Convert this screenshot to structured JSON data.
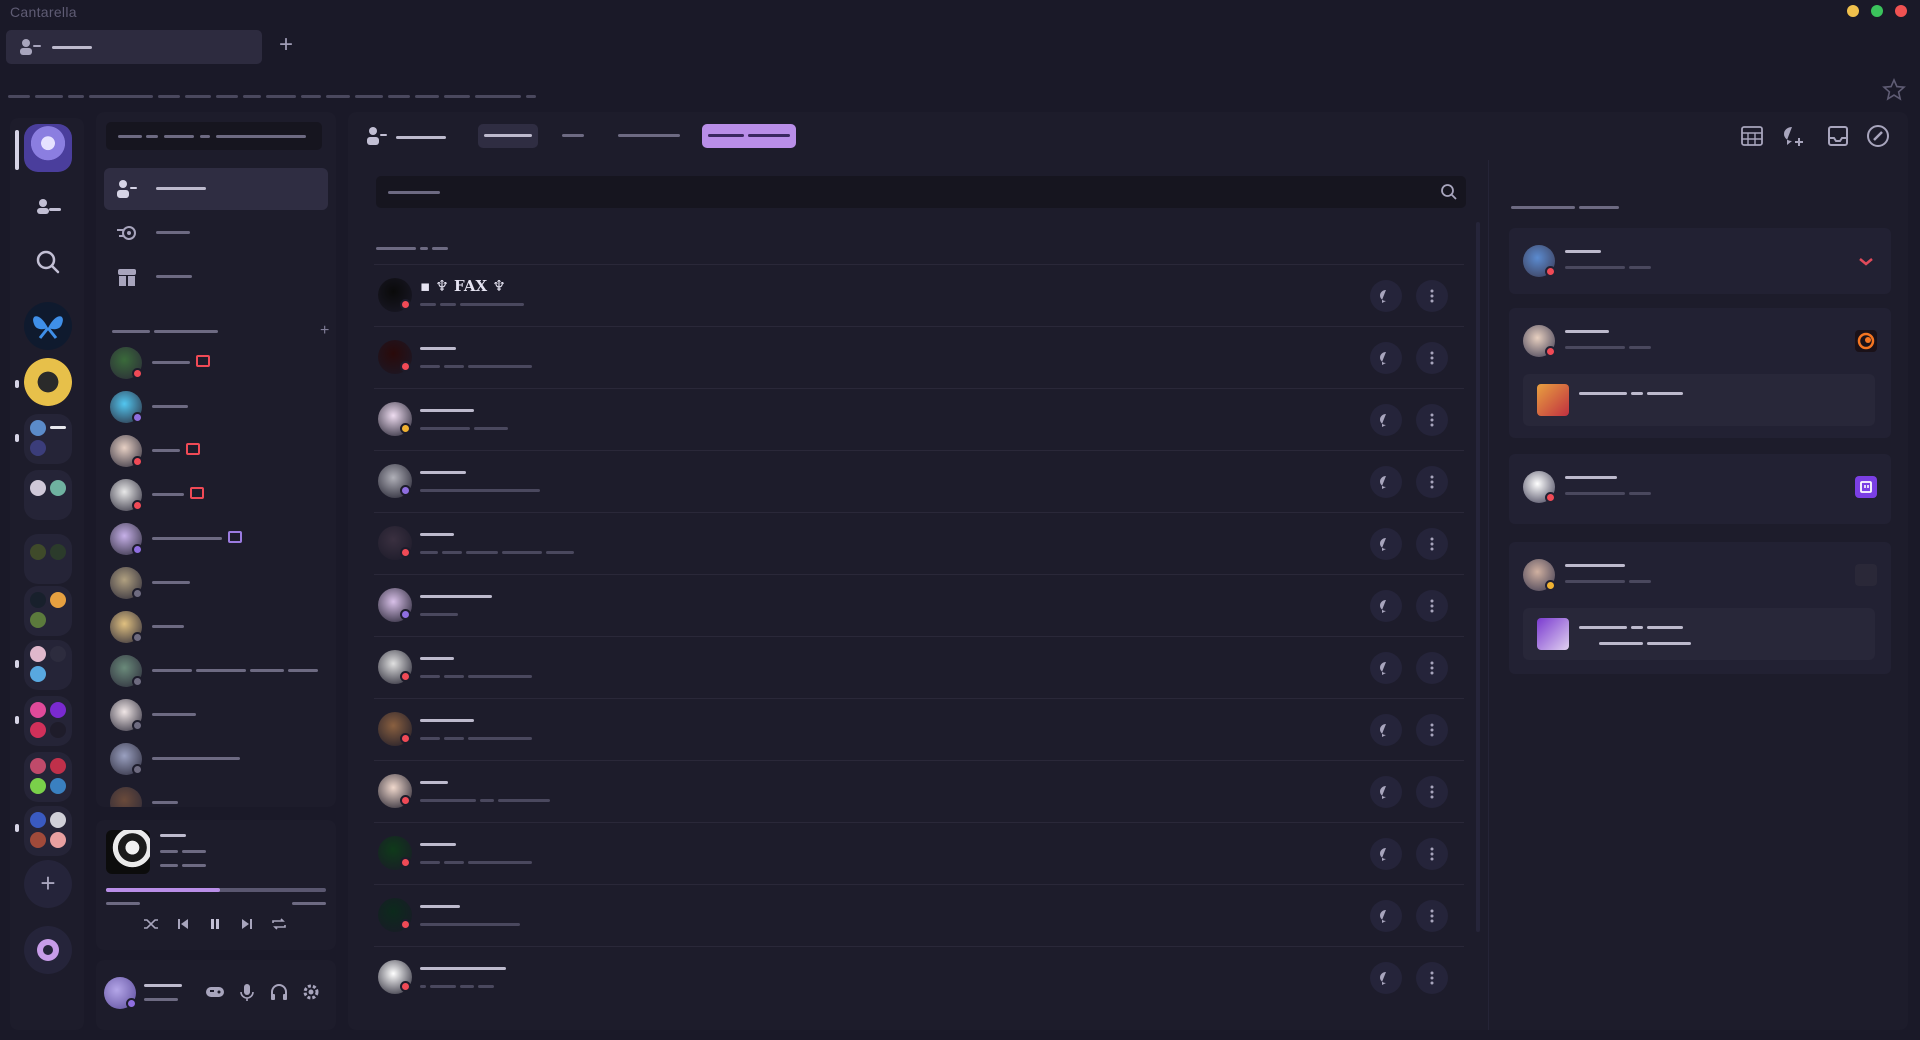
{
  "window": {
    "app_title": "Cantarella",
    "control_colors": [
      "#f0c04c",
      "#3bc35c",
      "#f05252"
    ],
    "new_tab_glyph": "+"
  },
  "tabs": [
    {
      "icon": "friends-icon"
    }
  ],
  "colors": {
    "accent": "#b98ee8",
    "online": "#8f6ee0",
    "dnd": "#f04a56",
    "idle": "#f0b232",
    "offline": "#6e6b80",
    "mobile": "#f04a56"
  },
  "rail": {
    "items": [
      "home-avatar",
      "friends-icon",
      "search-icon",
      "butterfly-server",
      "server-emblem",
      "folder",
      "folder",
      "folder",
      "folder",
      "folder",
      "folder",
      "folder",
      "add-server",
      "discover"
    ],
    "add_glyph": "+"
  },
  "sidebar": {
    "nav": [
      {
        "icon": "friends-icon",
        "active": true
      },
      {
        "icon": "nitro-icon",
        "active": false
      },
      {
        "icon": "shop-icon",
        "active": false
      }
    ],
    "dm_add_glyph": "+",
    "dms": [
      {
        "status": "dnd",
        "badge": "screen-share-icon"
      },
      {
        "status": "online",
        "badge": ""
      },
      {
        "status": "mobile",
        "badge": "game-icon"
      },
      {
        "status": "dnd",
        "badge": "screen-share-icon"
      },
      {
        "status": "online",
        "badge": "screen-share-icon"
      },
      {
        "status": "offline",
        "badge": ""
      },
      {
        "status": "offline",
        "badge": ""
      },
      {
        "status": "offline",
        "badge": ""
      },
      {
        "status": "offline",
        "badge": ""
      },
      {
        "status": "offline",
        "badge": ""
      },
      {
        "status": "offline",
        "badge": ""
      }
    ]
  },
  "player": {
    "progress": 0.52,
    "controls": [
      "shuffle-icon",
      "previous-icon",
      "pause-icon",
      "next-icon",
      "repeat-icon"
    ]
  },
  "userbar": {
    "icons": [
      "game-icon",
      "microphone-icon",
      "headphones-icon",
      "settings-icon"
    ]
  },
  "friends": {
    "rows": [
      {
        "name": "▪ ♆ FAX ♆",
        "status": "dnd"
      },
      {
        "name": "",
        "status": "dnd"
      },
      {
        "name": "",
        "status": "idle"
      },
      {
        "name": "",
        "status": "online"
      },
      {
        "name": "",
        "status": "dnd"
      },
      {
        "name": "",
        "status": "online"
      },
      {
        "name": "",
        "status": "dnd"
      },
      {
        "name": "",
        "status": "dnd"
      },
      {
        "name": "",
        "status": "mobile"
      },
      {
        "name": "",
        "status": "dnd"
      },
      {
        "name": "",
        "status": "dnd"
      },
      {
        "name": "",
        "status": "mobile"
      }
    ]
  },
  "active_now": {
    "cards": [
      {
        "status": "dnd",
        "app_icon": "chevron-icon"
      },
      {
        "status": "dnd",
        "app_icon": "crunchyroll-icon"
      },
      {
        "status": "dnd",
        "app_icon": "twitch-icon"
      },
      {
        "status": "idle",
        "app_icon": "game-art-icon"
      }
    ]
  }
}
